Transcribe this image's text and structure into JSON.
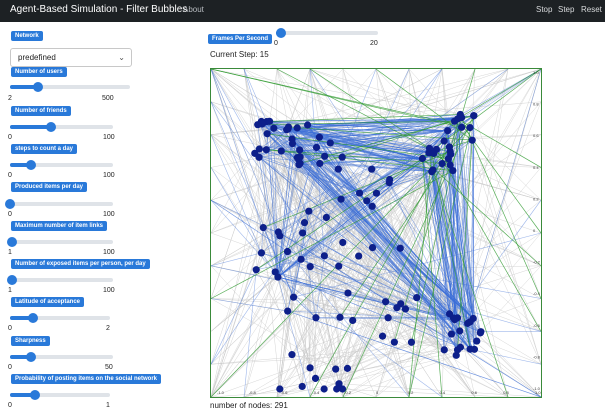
{
  "navbar": {
    "title": "Agent-Based Simulation - Filter Bubbles",
    "about": "About",
    "stop": "Stop",
    "step": "Step",
    "reset": "Reset"
  },
  "sidebar": {
    "network_label": "Network",
    "network_value": "predefined",
    "sliders": [
      {
        "id": "users",
        "label": "Number of users",
        "min": "2",
        "max": "500",
        "fraction": 0.23
      },
      {
        "id": "friends",
        "label": "Number of friends",
        "min": "0",
        "max": "100",
        "fraction": 0.4
      },
      {
        "id": "steps",
        "label": "steps to count a day",
        "min": "0",
        "max": "100",
        "fraction": 0.2
      },
      {
        "id": "produced",
        "label": "Produced items per day",
        "min": "0",
        "max": "100",
        "fraction": 0.0
      },
      {
        "id": "links",
        "label": "Maximum number of item links",
        "min": "1",
        "max": "100",
        "fraction": 0.02
      },
      {
        "id": "exposed",
        "label": "Number of exposed items per person, per day",
        "min": "1",
        "max": "100",
        "fraction": 0.02
      },
      {
        "id": "latitude",
        "label": "Latitude of acceptance",
        "min": "0",
        "max": "2",
        "fraction": 0.23
      },
      {
        "id": "sharpness",
        "label": "Sharpness",
        "min": "0",
        "max": "50",
        "fraction": 0.2
      },
      {
        "id": "probability",
        "label": "Probability of posting items on the social network",
        "min": "0",
        "max": "1",
        "fraction": 0.25
      }
    ]
  },
  "main": {
    "fps_label": "Frames Per Second",
    "fps_min": "0",
    "fps_max": "20",
    "fps_fraction": 0.05,
    "current_step": "Current Step: 15",
    "nodes_count": "number of nodes: 291"
  },
  "graph": {
    "x_ticks": [
      "-1.0",
      "-0.8",
      "-0.6",
      "-0.4",
      "-0.2",
      "0",
      "0.2",
      "0.4",
      "0.6",
      "0.8",
      "1.0"
    ],
    "y_ticks": [
      "1.0",
      "0.8",
      "0.6",
      "0.4",
      "0.2",
      "0",
      "-0.2",
      "-0.4",
      "-0.6",
      "-0.8",
      "-1.0"
    ],
    "colors": {
      "node": "#0d1f8a",
      "edge_gray": "#c8c8c8",
      "edge_blue": "#3d6fd8",
      "edge_green": "#2e9a2e",
      "frame": "#3a8a3a"
    }
  }
}
